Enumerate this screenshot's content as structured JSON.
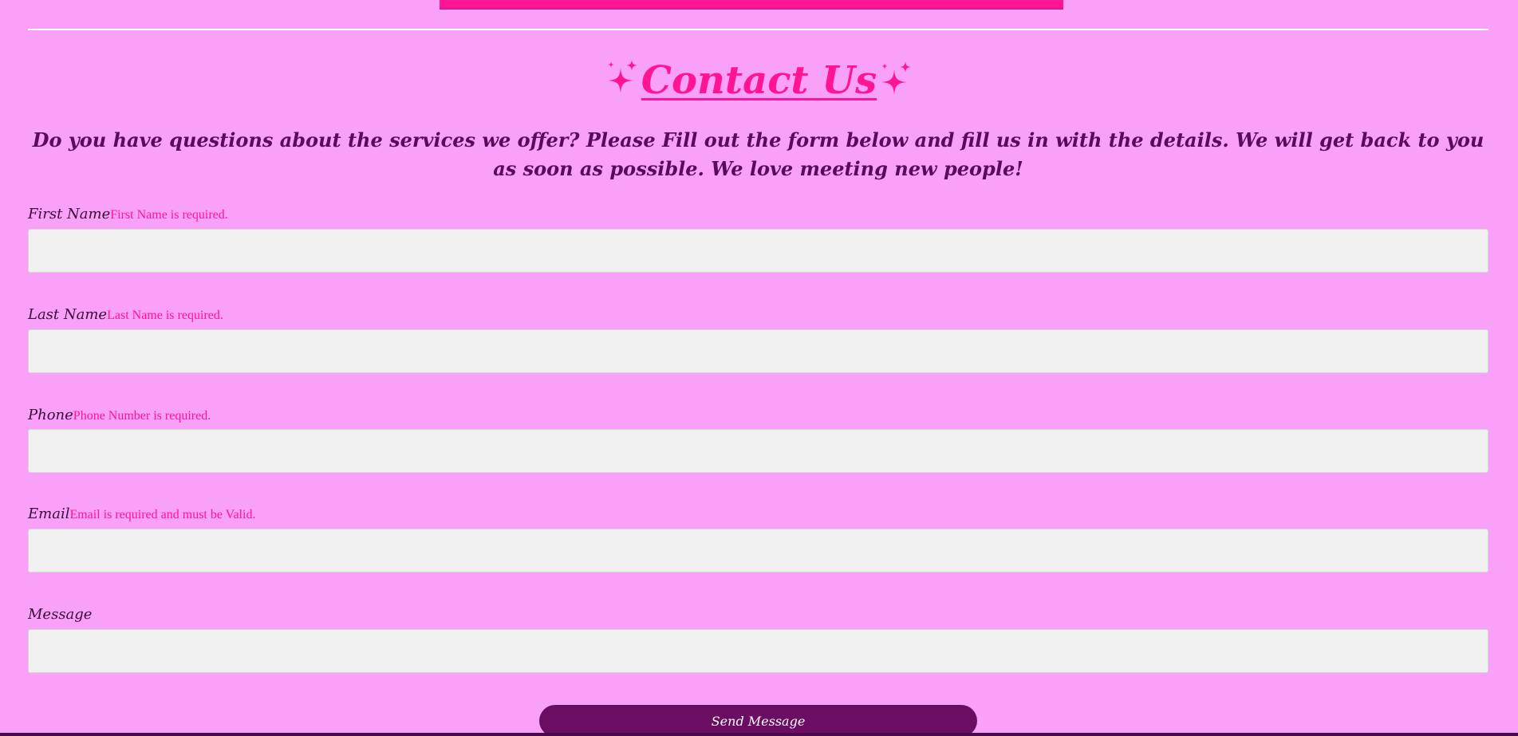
{
  "page": {
    "title": "Contact Us",
    "intro": "Do you have questions about the services we offer? Please Fill out the form below and fill us in with the details. We will get back to you as soon as possible. We love meeting new people!"
  },
  "form": {
    "fields": [
      {
        "label": "First Name",
        "error": "First Name is required.",
        "value": ""
      },
      {
        "label": "Last Name",
        "error": "Last Name is required.",
        "value": ""
      },
      {
        "label": "Phone",
        "error": "Phone Number is required.",
        "value": ""
      },
      {
        "label": "Email",
        "error": "Email is required and must be Valid.",
        "value": ""
      },
      {
        "label": "Message",
        "error": "",
        "value": ""
      }
    ],
    "submit_label": "Send Message"
  },
  "colors": {
    "background": "#f9a0f8",
    "accent": "#ff1493",
    "text_dark": "#5a0a5a",
    "button": "#6b0e63",
    "input_bg": "#f0f0f0"
  },
  "icons": {
    "title_left": "sparkles-icon",
    "title_right": "sparkles-icon"
  }
}
